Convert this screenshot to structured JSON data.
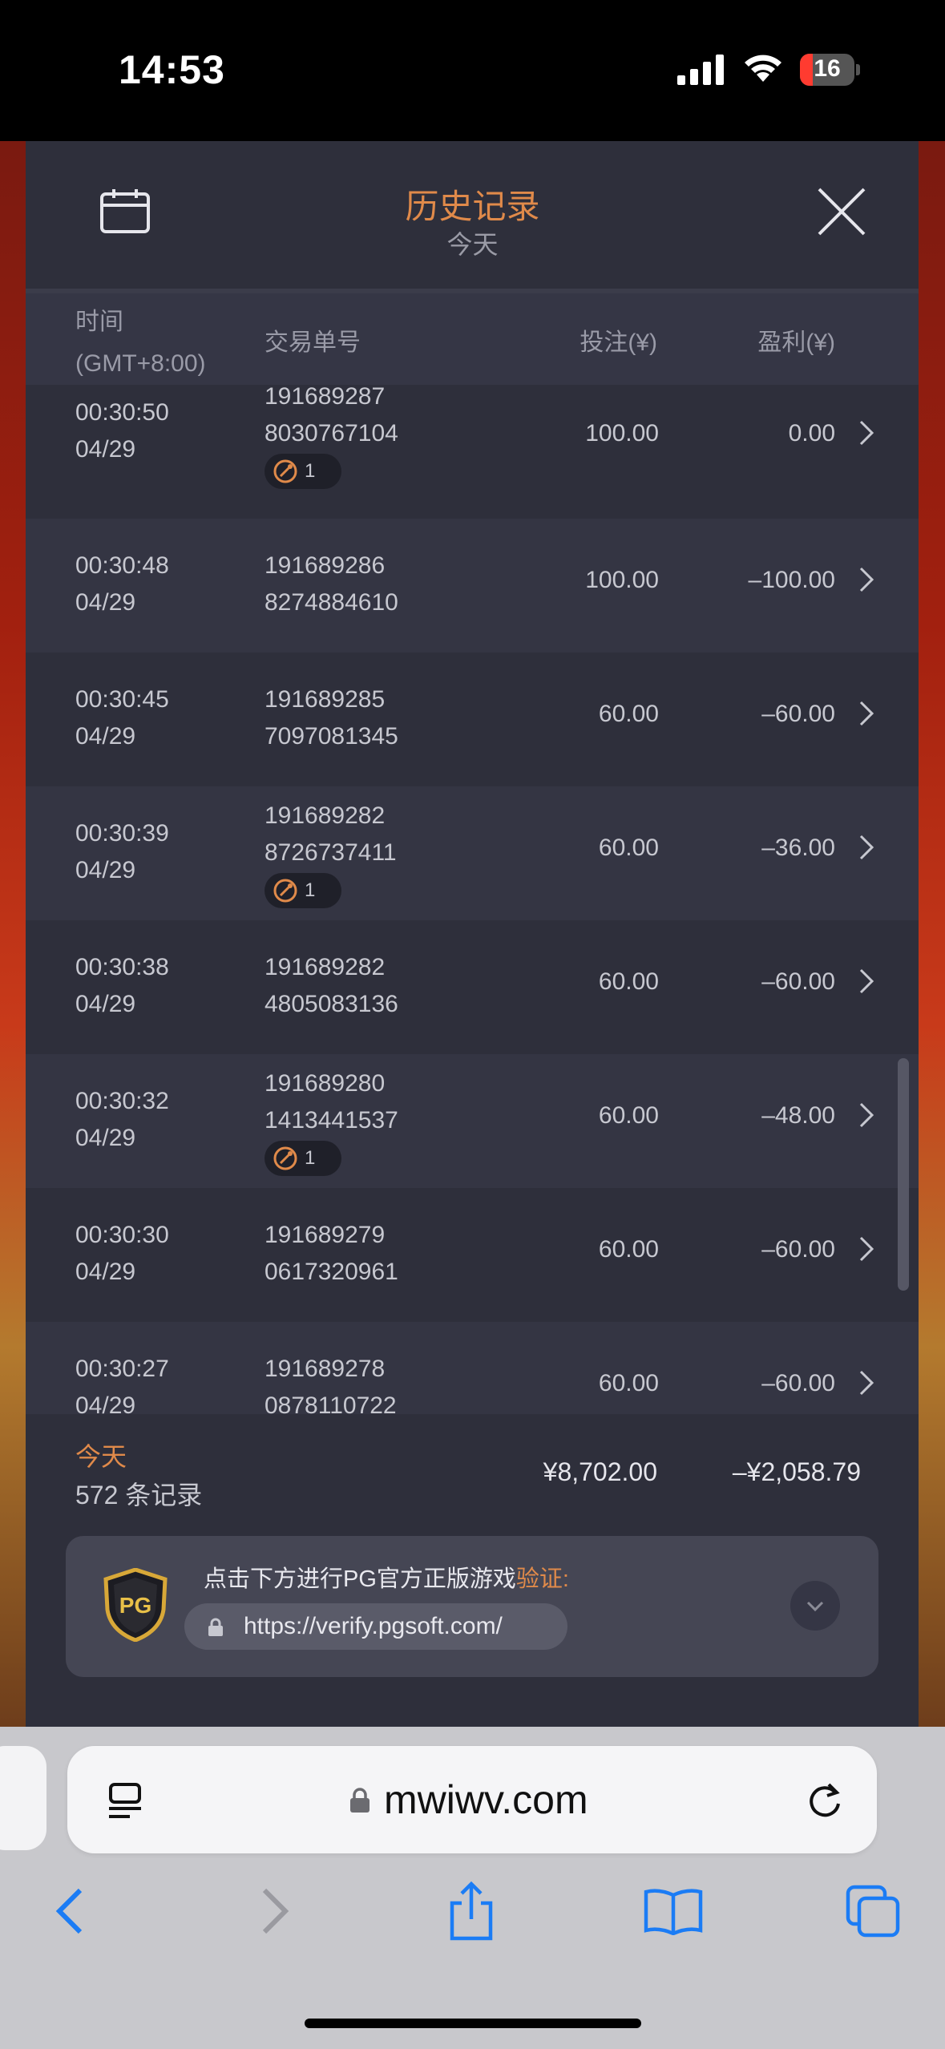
{
  "status_bar": {
    "time": "14:53",
    "battery": "16"
  },
  "modal": {
    "title": "历史记录",
    "subtitle": "今天",
    "columns": {
      "time_line1": "时间",
      "time_line2": "(GMT+8:00)",
      "txn": "交易单号",
      "bet": "投注(¥)",
      "profit": "盈利(¥)"
    },
    "rows": [
      {
        "time": "00:30:50",
        "date": "04/29",
        "id1": "191689287",
        "id2": "8030767104",
        "bet": "100.00",
        "profit": "0.00",
        "badge": "1"
      },
      {
        "time": "00:30:48",
        "date": "04/29",
        "id1": "191689286",
        "id2": "8274884610",
        "bet": "100.00",
        "profit": "–100.00"
      },
      {
        "time": "00:30:45",
        "date": "04/29",
        "id1": "191689285",
        "id2": "7097081345",
        "bet": "60.00",
        "profit": "–60.00"
      },
      {
        "time": "00:30:39",
        "date": "04/29",
        "id1": "191689282",
        "id2": "8726737411",
        "bet": "60.00",
        "profit": "–36.00",
        "badge": "1"
      },
      {
        "time": "00:30:38",
        "date": "04/29",
        "id1": "191689282",
        "id2": "4805083136",
        "bet": "60.00",
        "profit": "–60.00"
      },
      {
        "time": "00:30:32",
        "date": "04/29",
        "id1": "191689280",
        "id2": "1413441537",
        "bet": "60.00",
        "profit": "–48.00",
        "badge": "1"
      },
      {
        "time": "00:30:30",
        "date": "04/29",
        "id1": "191689279",
        "id2": "0617320961",
        "bet": "60.00",
        "profit": "–60.00"
      },
      {
        "time": "00:30:27",
        "date": "04/29",
        "id1": "191689278",
        "id2": "0878110722",
        "bet": "60.00",
        "profit": "–60.00"
      }
    ],
    "footer": {
      "label": "今天",
      "count": "572 条记录",
      "total_bet": "¥8,702.00",
      "total_profit": "–¥2,058.79"
    },
    "verify": {
      "text": "点击下方进行PG官方正版游戏",
      "accent": "验证:",
      "url": "https://verify.pgsoft.com/",
      "logo": "PG"
    }
  },
  "browser": {
    "domain": "mwiwv.com"
  },
  "colors": {
    "accent": "#e08a4a",
    "panel": "#2e2f3b",
    "ios_blue": "#1b7cf5"
  }
}
